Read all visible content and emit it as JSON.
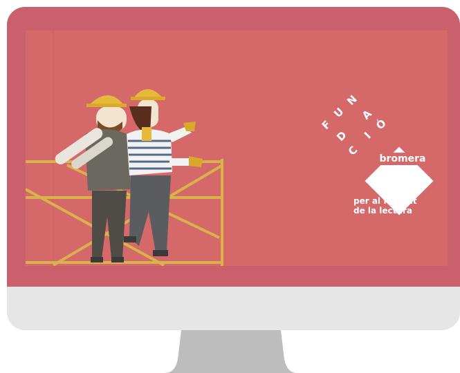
{
  "logo": {
    "fundacio_letters": [
      "F",
      "U",
      "N",
      "D",
      "A",
      "C",
      "I",
      "Ó"
    ],
    "brand": "bromera",
    "tagline_line1": "per al foment",
    "tagline_line2": "de la lectura"
  },
  "colors": {
    "frame": "#c9606c",
    "wall": "#d5696a",
    "chin": "#e6e6e6",
    "stand": "#bdbdbd",
    "scaffold": "#d8b24a"
  },
  "illustration": {
    "subject": "two workers in hard hats on scaffolding"
  }
}
